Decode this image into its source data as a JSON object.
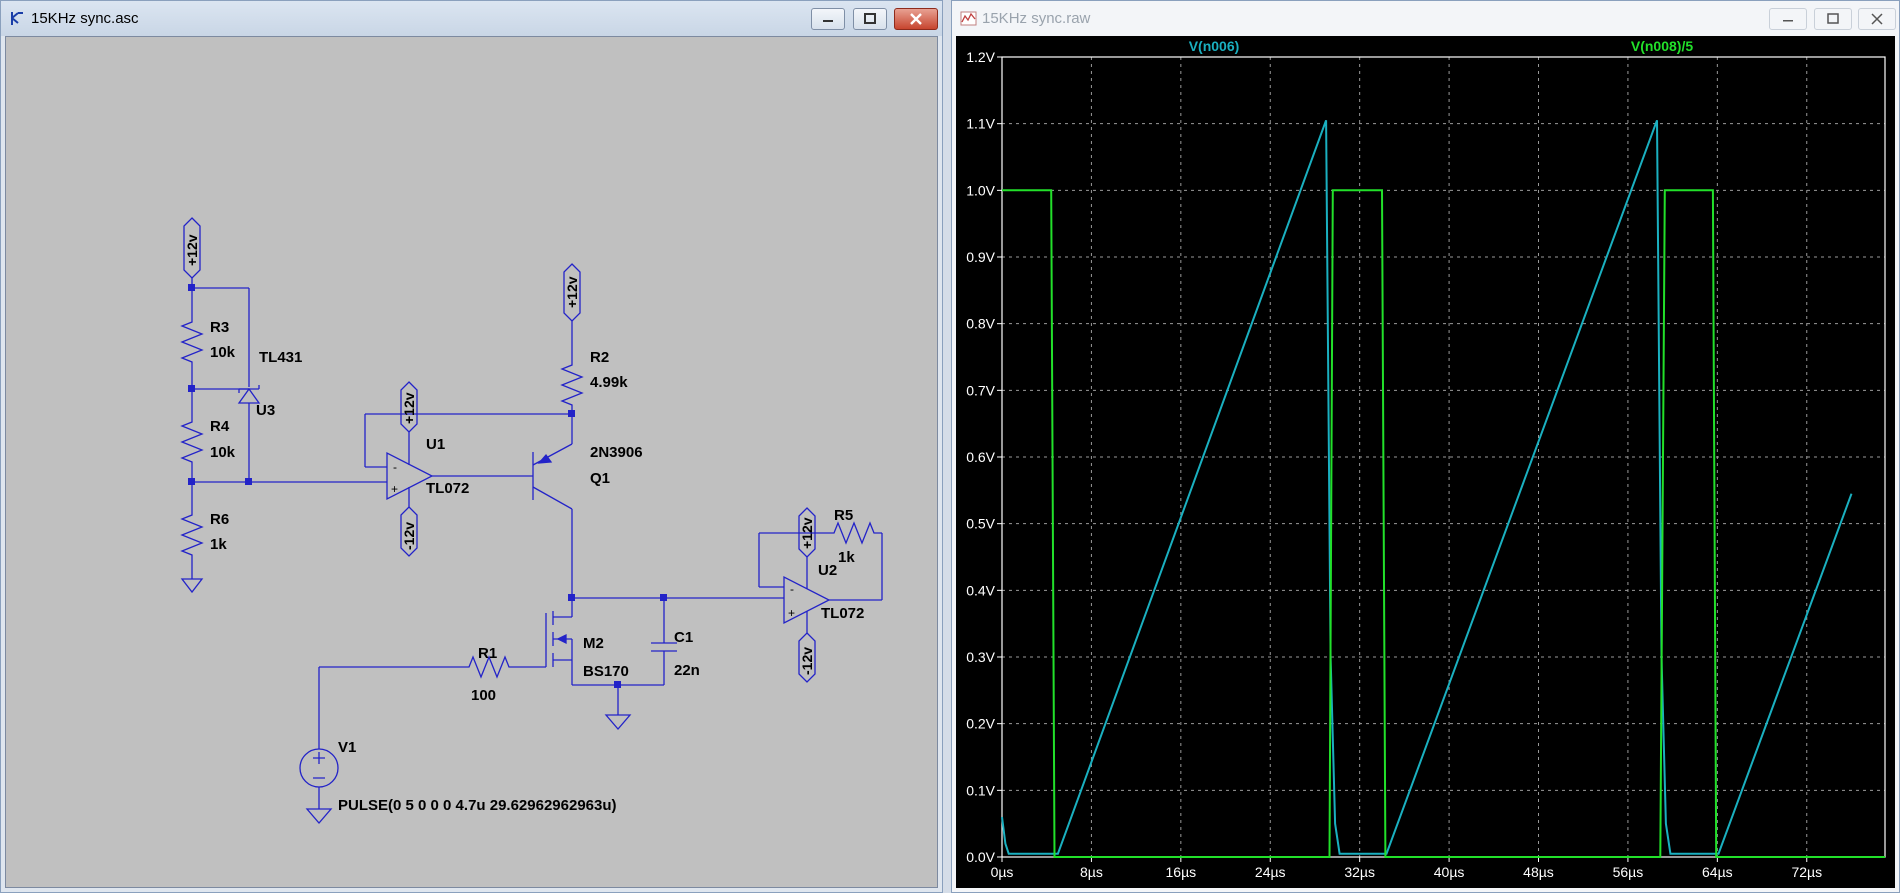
{
  "schematic_window": {
    "title": "15KHz sync.asc",
    "controls": [
      "minimize",
      "maximize",
      "close"
    ],
    "components": {
      "r3": {
        "ref": "R3",
        "value": "10k"
      },
      "r4": {
        "ref": "R4",
        "value": "10k"
      },
      "r6": {
        "ref": "R6",
        "value": "1k"
      },
      "u3": {
        "ref": "U3",
        "value": "TL431"
      },
      "u1": {
        "ref": "U1",
        "value": "TL072"
      },
      "r2": {
        "ref": "R2",
        "value": "4.99k"
      },
      "q1": {
        "ref": "Q1",
        "value": "2N3906"
      },
      "u2": {
        "ref": "U2",
        "value": "TL072"
      },
      "r5": {
        "ref": "R5",
        "value": "1k"
      },
      "m2": {
        "ref": "M2",
        "value": "BS170"
      },
      "c1": {
        "ref": "C1",
        "value": "22n"
      },
      "r1": {
        "ref": "R1",
        "value": "100"
      },
      "v1": {
        "ref": "V1",
        "value": "PULSE(0 5 0 0 0 4.7u  29.62962962963u)"
      }
    },
    "net_flags": {
      "vplus": "+12v",
      "vminus": "-12v"
    }
  },
  "waveform_window": {
    "title": "15KHz sync.raw",
    "controls": [
      "minimize",
      "maximize",
      "close"
    ]
  },
  "chart_data": {
    "type": "line",
    "xlabel": "",
    "ylabel": "",
    "x_unit": "µs",
    "y_unit": "V",
    "xlim": [
      0,
      79
    ],
    "ylim": [
      0,
      1.2
    ],
    "x_ticks": [
      "0µs",
      "8µs",
      "16µs",
      "24µs",
      "32µs",
      "40µs",
      "48µs",
      "56µs",
      "64µs",
      "72µs"
    ],
    "y_ticks": [
      "0.0V",
      "0.1V",
      "0.2V",
      "0.3V",
      "0.4V",
      "0.5V",
      "0.6V",
      "0.7V",
      "0.8V",
      "0.9V",
      "1.0V",
      "1.1V",
      "1.2V"
    ],
    "grid": true,
    "legend": "top",
    "series": [
      {
        "name": "V(n006)",
        "color": "#1ab0c0",
        "x": [
          0,
          0.3,
          0.6,
          4.7,
          5.0,
          29.0,
          29.4,
          29.8,
          30.2,
          34.1,
          34.4,
          58.6,
          59.0,
          59.4,
          59.8,
          63.8,
          64.1,
          76.0
        ],
        "y": [
          0.06,
          0.02,
          0.005,
          0.005,
          0.005,
          1.105,
          0.3,
          0.05,
          0.005,
          0.005,
          0.005,
          1.105,
          0.3,
          0.05,
          0.005,
          0.005,
          0.005,
          0.545
        ]
      },
      {
        "name": "V(n008)/5",
        "color": "#22e02a",
        "x": [
          0,
          4.4,
          4.7,
          29.3,
          29.6,
          34.0,
          34.3,
          58.9,
          59.3,
          63.6,
          63.9,
          79
        ],
        "y": [
          1.0,
          1.0,
          0.0,
          0.0,
          1.0,
          1.0,
          0.0,
          0.0,
          1.0,
          1.0,
          0.0,
          0.0
        ]
      }
    ]
  }
}
